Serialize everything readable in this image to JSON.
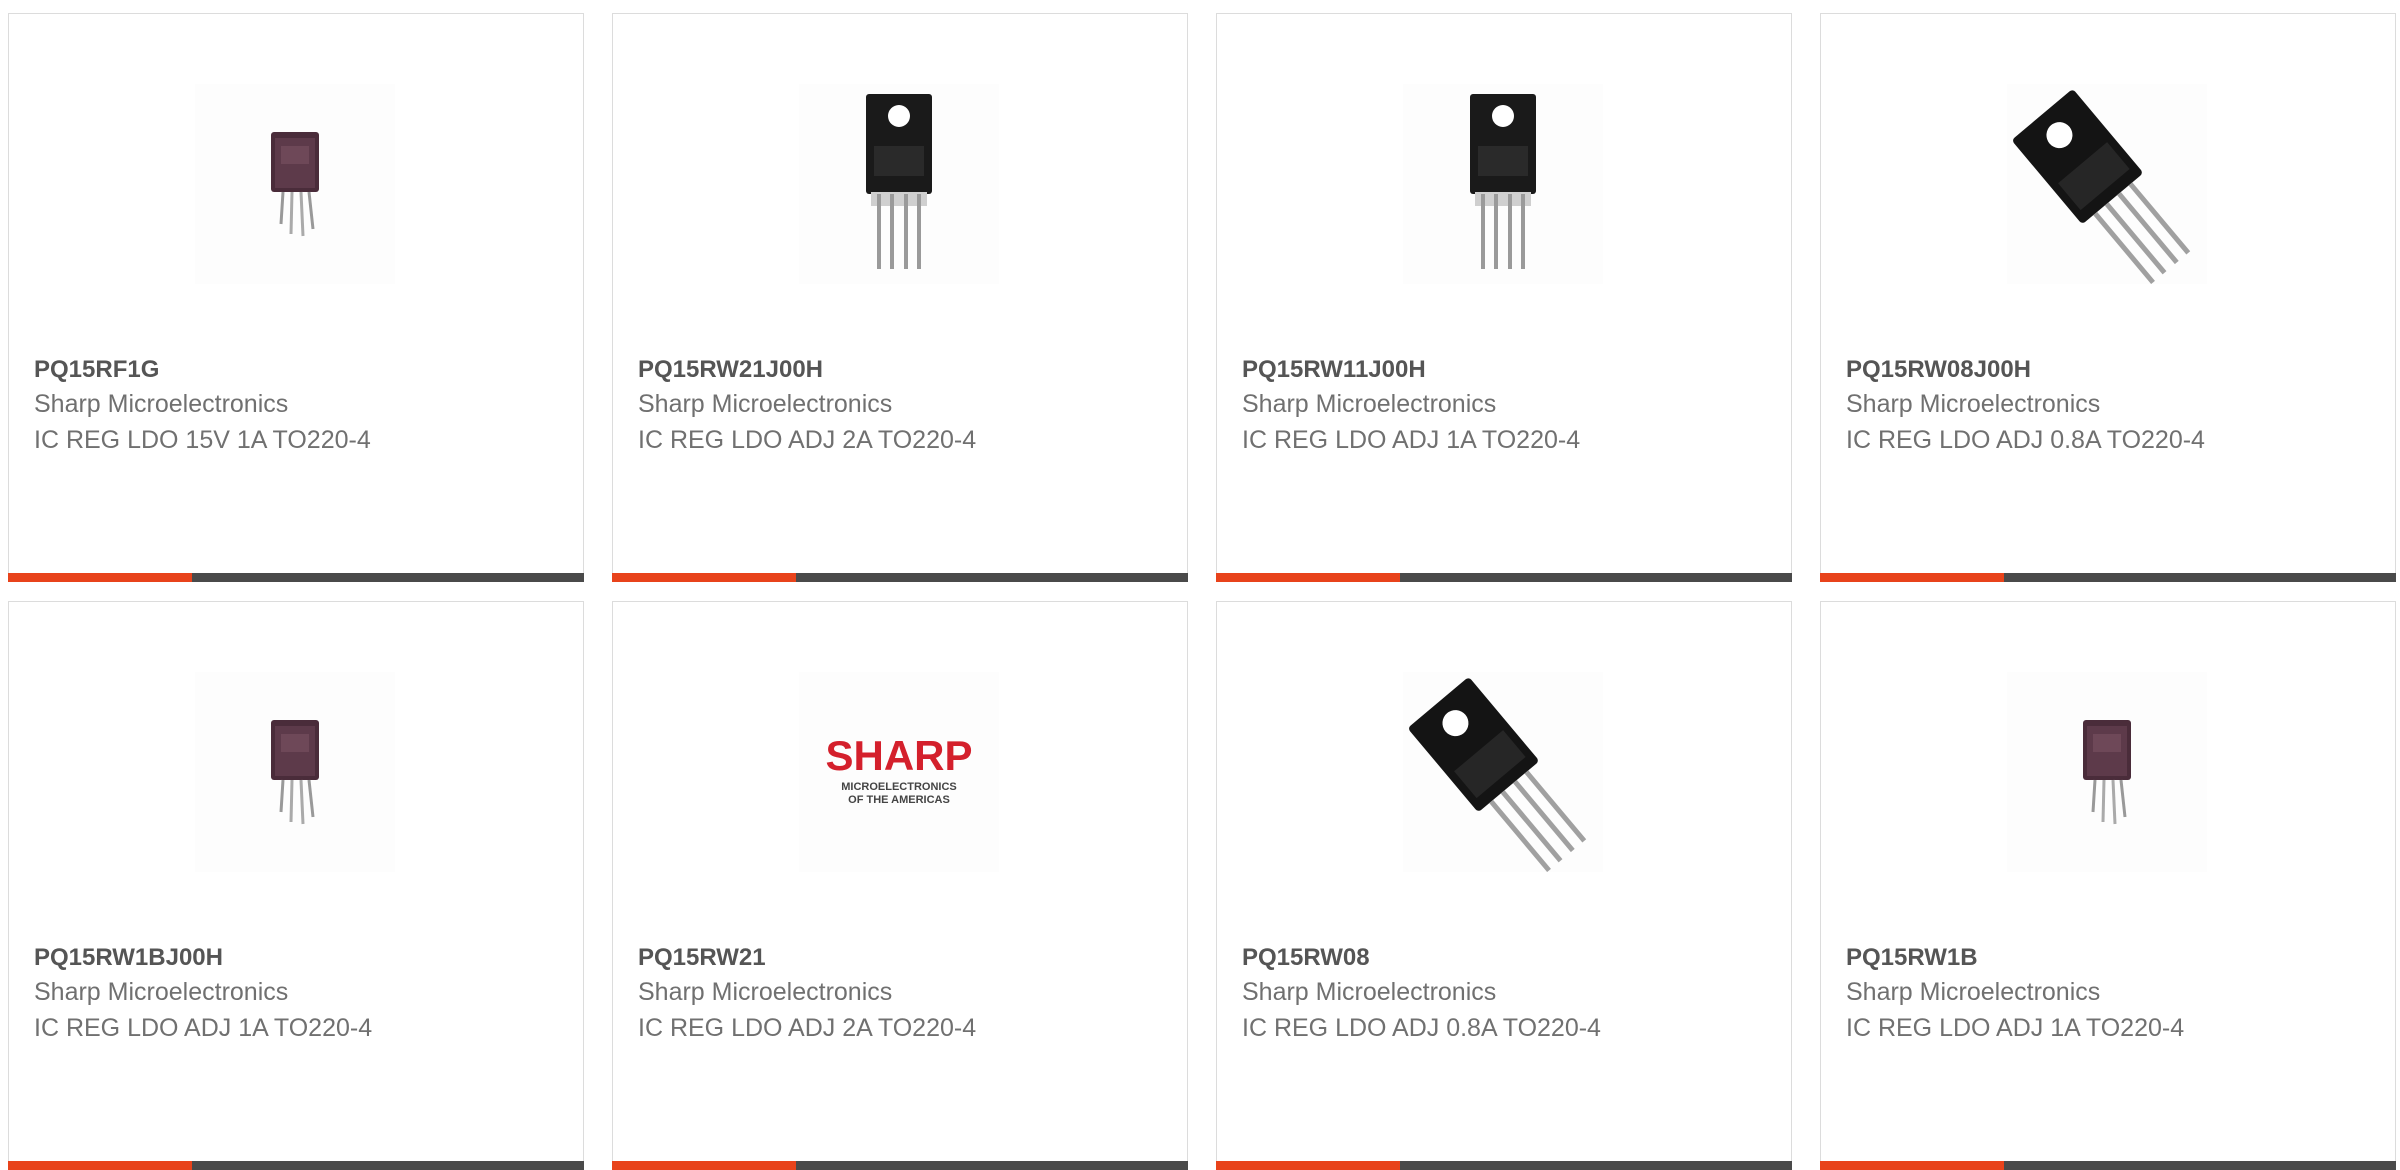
{
  "products": [
    {
      "part_number": "PQ15RF1G",
      "manufacturer": "Sharp Microelectronics",
      "description": "IC REG LDO 15V 1A TO220-4",
      "image": "to220-small-brown"
    },
    {
      "part_number": "PQ15RW21J00H",
      "manufacturer": "Sharp Microelectronics",
      "description": "IC REG LDO ADJ 2A TO220-4",
      "image": "to220-front"
    },
    {
      "part_number": "PQ15RW11J00H",
      "manufacturer": "Sharp Microelectronics",
      "description": "IC REG LDO ADJ 1A TO220-4",
      "image": "to220-front"
    },
    {
      "part_number": "PQ15RW08J00H",
      "manufacturer": "Sharp Microelectronics",
      "description": "IC REG LDO ADJ 0.8A TO220-4",
      "image": "to220-angled"
    },
    {
      "part_number": "PQ15RW1BJ00H",
      "manufacturer": "Sharp Microelectronics",
      "description": "IC REG LDO ADJ 1A TO220-4",
      "image": "to220-small-brown"
    },
    {
      "part_number": "PQ15RW21",
      "manufacturer": "Sharp Microelectronics",
      "description": "IC REG LDO ADJ 2A TO220-4",
      "image": "sharp-logo"
    },
    {
      "part_number": "PQ15RW08",
      "manufacturer": "Sharp Microelectronics",
      "description": "IC REG LDO ADJ 0.8A TO220-4",
      "image": "to220-angled"
    },
    {
      "part_number": "PQ15RW1B",
      "manufacturer": "Sharp Microelectronics",
      "description": "IC REG LDO ADJ 1A TO220-4",
      "image": "to220-small-brown"
    }
  ],
  "logo": {
    "brand": "SHARP",
    "line1": "MICROELECTRONICS",
    "line2": "OF THE AMERICAS"
  },
  "colors": {
    "accent": "#e8431b",
    "bar": "#4a4a4a",
    "part_number": "#555555",
    "text": "#707070",
    "border": "#dcdcdc"
  }
}
